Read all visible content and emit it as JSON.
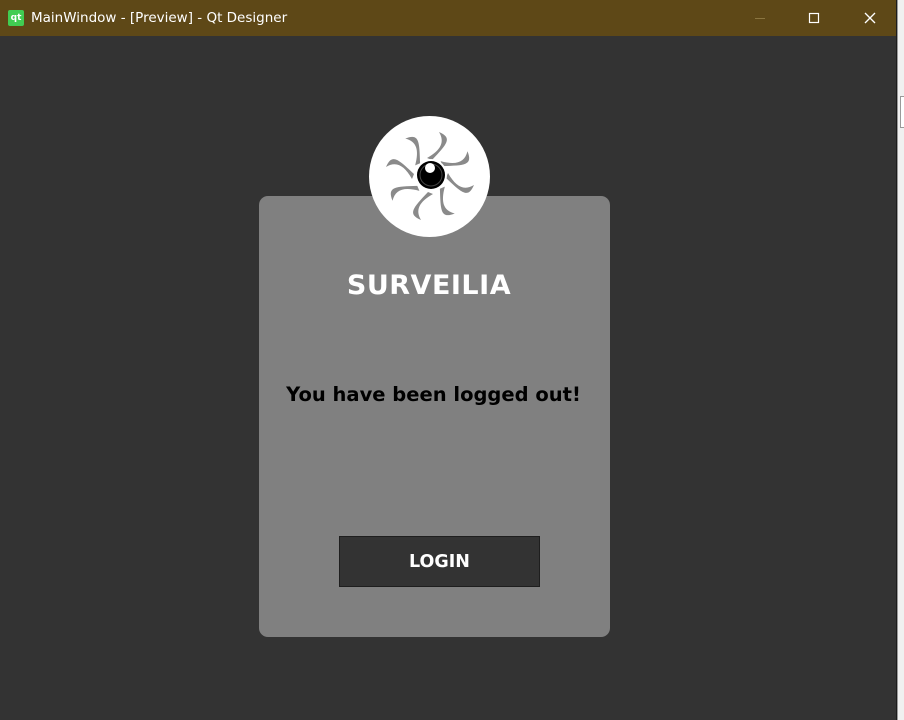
{
  "window": {
    "title": "MainWindow - [Preview] - Qt Designer",
    "app_icon_label": "qt",
    "background": "#333333",
    "titlebar_color": "#5e4817"
  },
  "titlebar_buttons": [
    "minimize-icon",
    "maximize-icon",
    "close-icon"
  ],
  "logo": {
    "icon": "eye-aperture-icon"
  },
  "card": {
    "brand": "SURVEILIA",
    "message": "You have been logged out!",
    "login_label": "LOGIN",
    "background": "#808080"
  }
}
